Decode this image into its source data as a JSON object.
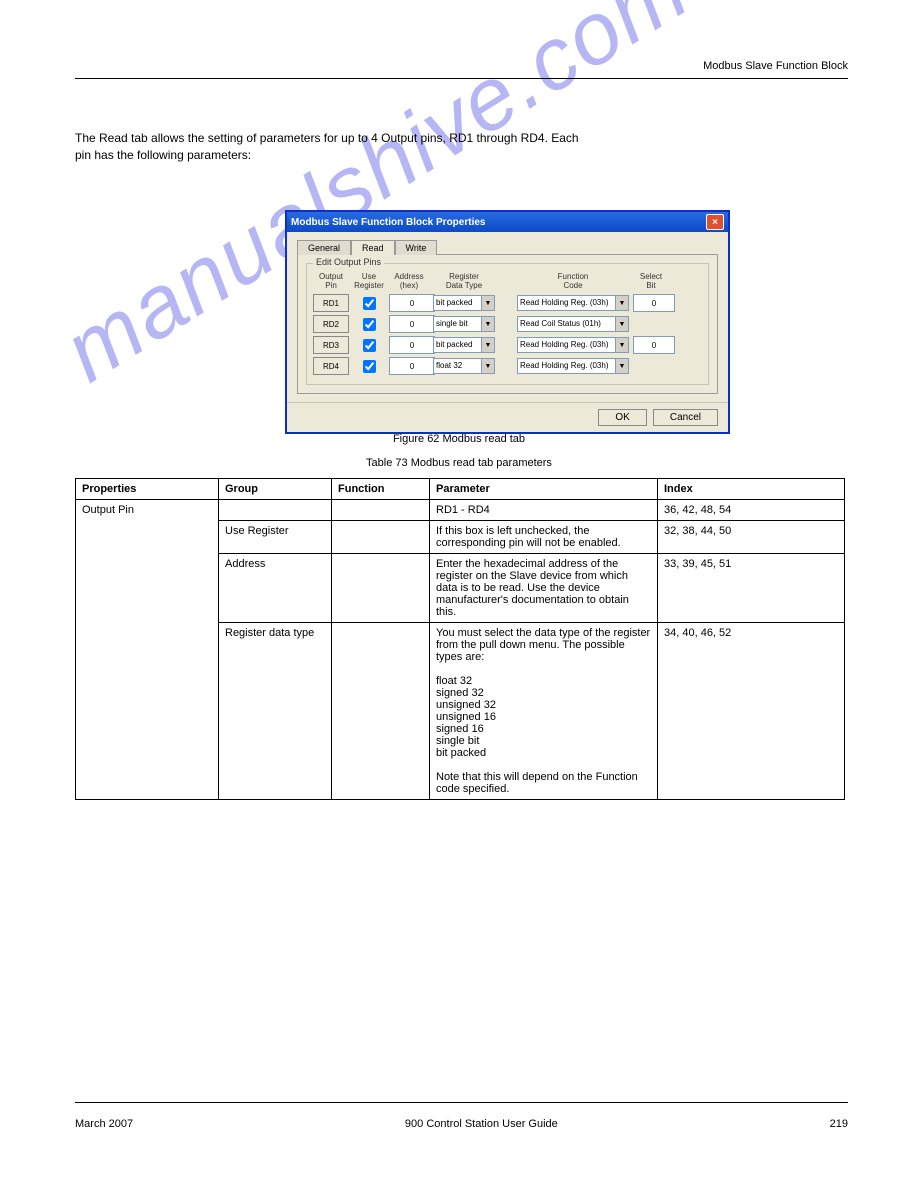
{
  "header": {
    "title": "Modbus Slave Function Block"
  },
  "intro": {
    "line1": "The Read tab allows the setting of parameters for up to 4 Output pins, RD1 through RD4. Each ",
    "line2": "pin has the following parameters:"
  },
  "dialog": {
    "title": "Modbus Slave Function Block Properties",
    "tabs": {
      "general": "General",
      "read": "Read",
      "write": "Write"
    },
    "group_label": "Edit Output Pins",
    "headers": {
      "output": "Output\nPin",
      "use": "Use\nRegister",
      "addr": "Address\n(hex)",
      "dtype": "Register\nData Type",
      "fcode": "Function\nCode",
      "sbit": "Select\nBit"
    },
    "rows": [
      {
        "pin": "RD1",
        "use": true,
        "addr": "0",
        "dtype": "bit packed",
        "fcode": "Read Holding Reg. (03h)",
        "sbit": "0"
      },
      {
        "pin": "RD2",
        "use": true,
        "addr": "0",
        "dtype": "single bit",
        "fcode": "Read Coil Status (01h)",
        "sbit": ""
      },
      {
        "pin": "RD3",
        "use": true,
        "addr": "0",
        "dtype": "bit packed",
        "fcode": "Read Holding Reg. (03h)",
        "sbit": "0"
      },
      {
        "pin": "RD4",
        "use": true,
        "addr": "0",
        "dtype": "float 32",
        "fcode": "Read Holding Reg. (03h)",
        "sbit": ""
      }
    ],
    "ok": "OK",
    "cancel": "Cancel"
  },
  "fig_caption": "Figure 62 Modbus read tab",
  "tbl_caption": "Table 73 Modbus read tab parameters",
  "table": {
    "headers": [
      "Properties",
      "Group",
      "Function",
      "Parameter",
      "Index"
    ],
    "rows": [
      {
        "prop": "Output Pin",
        "group": "",
        "func": "",
        "param": "RD1 - RD4",
        "index": "36, 42, 48, 54"
      },
      {
        "prop": "",
        "group": "Use Register",
        "func": "",
        "param": "If this box is left unchecked, the corresponding pin will not be enabled.",
        "index": "32, 38, 44, 50"
      },
      {
        "prop": "",
        "group": "Address",
        "func": "",
        "param": "Enter the hexadecimal address of the register on the Slave device from which data is to be read. Use the device manufacturer's documentation to obtain this.",
        "index": "33, 39, 45, 51"
      },
      {
        "prop": "",
        "group": "Register data type",
        "func": "",
        "param": "You must select the data type of the register from the pull down menu.  The possible types are:\n\nfloat 32\nsigned 32\nunsigned 32\nunsigned 16\nsigned 16\nsingle bit\nbit packed\n\nNote that this will depend on the Function code specified.",
        "index": "34, 40, 46, 52"
      }
    ]
  },
  "footer": {
    "date": "March 2007",
    "doc": "900 Control Station  User Guide",
    "page": "219"
  },
  "watermark": "manualshive.com"
}
